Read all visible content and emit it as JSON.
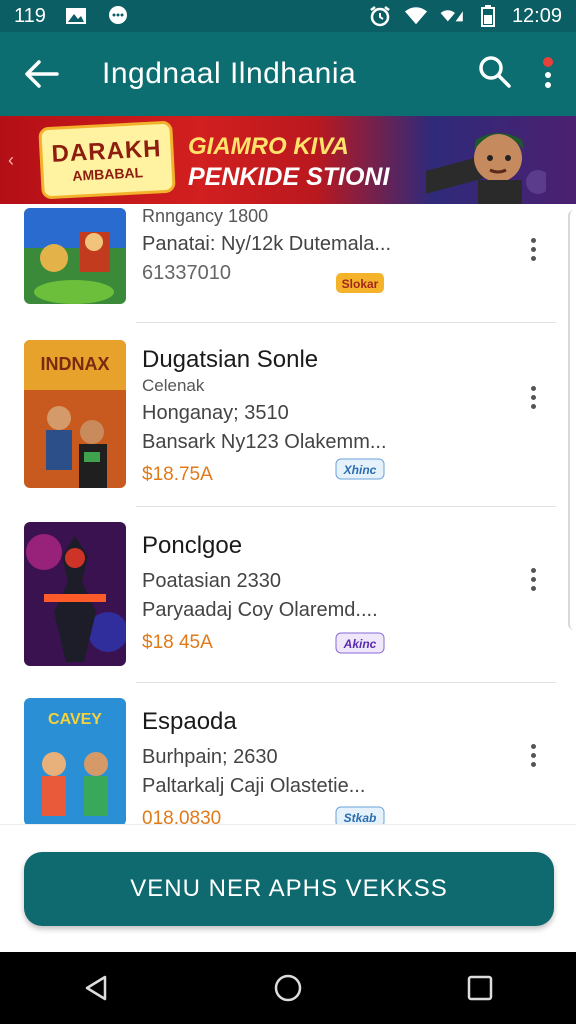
{
  "status_bar": {
    "time_left": "119",
    "clock": "12:09",
    "icons": [
      "gallery-icon",
      "chat-icon",
      "alarm-icon",
      "wifi-icon",
      "signal-icon",
      "battery-icon"
    ]
  },
  "app_bar": {
    "title": "Ingdnaal Ilndhania",
    "icons": [
      "back-arrow-icon",
      "search-icon",
      "more-vert-icon"
    ]
  },
  "banner": {
    "logo_line1": "DARAKH",
    "logo_line2": "AMBABAL",
    "headline_line1": "GIAMRO KIVA",
    "headline_line2": "PENKIDE STIONI"
  },
  "apps": [
    {
      "name": "Rnngancy 1800",
      "line1": "Panatai: Ny/12k Dutemala...",
      "price": "61337010",
      "badge": "Slokar"
    },
    {
      "name": "Dugatsian Sonle",
      "sub": "Celenak",
      "line1": "Honganay; 3510",
      "line2": "Bansark Ny123 Olakemm...",
      "price": "$18.75A",
      "badge": "Xhinc"
    },
    {
      "name": "Ponclgoe",
      "line1": "Poatasian 2330",
      "line2": "Paryaadaj Coy Olaremd....",
      "price": "$18 45A",
      "badge": "Akinc"
    },
    {
      "name": "Espaoda",
      "line1": "Burhpain; 2630",
      "line2": "Paltarkalj Caji Olastetie...",
      "price": "018.0830",
      "badge": "Stkab"
    }
  ],
  "cta": {
    "label": "VENU NER APHS VEKKSS"
  },
  "nav": {
    "icons": [
      "back-triangle-icon",
      "home-circle-icon",
      "recents-square-icon"
    ]
  },
  "colors": {
    "primary": "#0d6e72",
    "status": "#0b5e63",
    "price": "#e07a1a"
  }
}
